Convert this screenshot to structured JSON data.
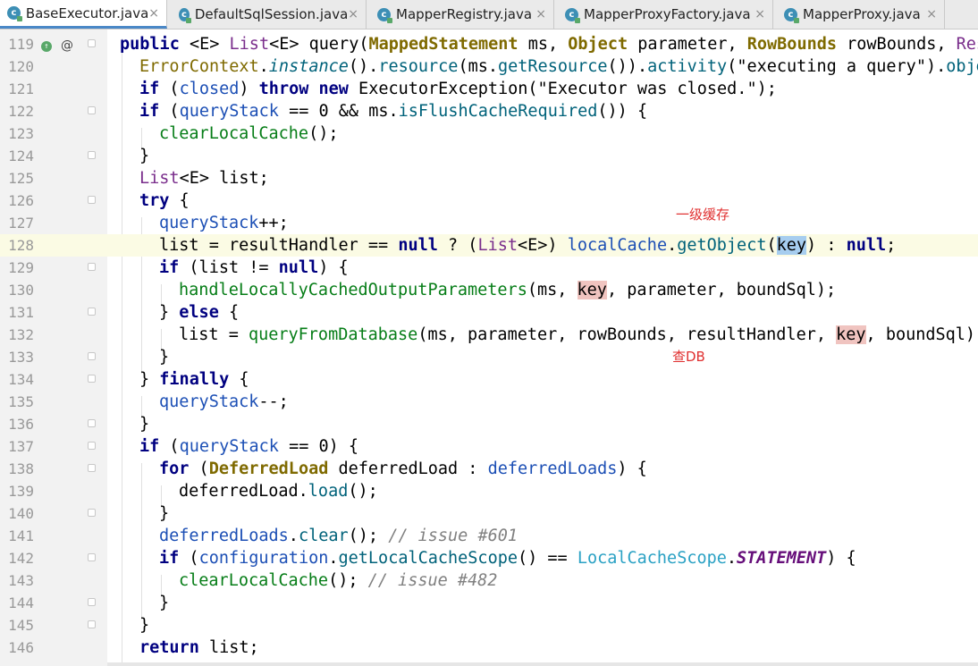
{
  "tabs": [
    {
      "label": "BaseExecutor.java",
      "active": true
    },
    {
      "label": "DefaultSqlSession.java",
      "active": false
    },
    {
      "label": "MapperRegistry.java",
      "active": false
    },
    {
      "label": "MapperProxyFactory.java",
      "active": false
    },
    {
      "label": "MapperProxy.java",
      "active": false
    }
  ],
  "tab_close_glyph": "×",
  "file_icon_letter": "c",
  "gutter": {
    "override_icon": "implements-method-icon",
    "annotation_icon": "@"
  },
  "lines": [
    {
      "n": "119"
    },
    {
      "n": "120"
    },
    {
      "n": "121"
    },
    {
      "n": "122"
    },
    {
      "n": "123"
    },
    {
      "n": "124"
    },
    {
      "n": "125"
    },
    {
      "n": "126"
    },
    {
      "n": "127"
    },
    {
      "n": "128"
    },
    {
      "n": "129"
    },
    {
      "n": "130"
    },
    {
      "n": "131"
    },
    {
      "n": "132"
    },
    {
      "n": "133"
    },
    {
      "n": "134"
    },
    {
      "n": "135"
    },
    {
      "n": "136"
    },
    {
      "n": "137"
    },
    {
      "n": "138"
    },
    {
      "n": "139"
    },
    {
      "n": "140"
    },
    {
      "n": "141"
    },
    {
      "n": "142"
    },
    {
      "n": "143"
    },
    {
      "n": "144"
    },
    {
      "n": "145"
    },
    {
      "n": "146"
    }
  ],
  "code": {
    "l119": {
      "a": "public ",
      "b": "<E> ",
      "c": "List",
      "d": "<E> query(",
      "e": "MappedStatement",
      "f": " ms, ",
      "g": "Object",
      "h": " parameter, ",
      "i": "RowBounds",
      "j": " rowBounds, ",
      "k": "Resu"
    },
    "l120": {
      "a": "ErrorContext",
      "b": ".",
      "c": "instance",
      "d": "().",
      "e": "resource",
      "f": "(ms.",
      "g": "getResource",
      "h": "()).",
      "i": "activity",
      "j": "(\"executing a query\").",
      "k": "objec"
    },
    "l121": {
      "a": "if",
      "b": " (",
      "c": "closed",
      "d": ") ",
      "e": "throw new",
      "f": " ExecutorException(\"Executor was closed.\");"
    },
    "l122": {
      "a": "if",
      "b": " (",
      "c": "queryStack",
      "d": " == ",
      "e": "0",
      "f": " && ms.",
      "g": "isFlushCacheRequired",
      "h": "()) {"
    },
    "l123": {
      "a": "clearLocalCache",
      "b": "();"
    },
    "l124": {
      "a": "}"
    },
    "l125": {
      "a": "List",
      "b": "<E> list;"
    },
    "l126": {
      "a": "try",
      "b": " {"
    },
    "l127": {
      "a": "queryStack",
      "b": "++;"
    },
    "l128": {
      "a": "list = resultHandler == ",
      "b": "null",
      "c": " ? (",
      "d": "List",
      "e": "<E>) ",
      "f": "localCache",
      "g": ".",
      "h": "getObject",
      "i": "(",
      "j": "key",
      "k": ") : ",
      "l": "null",
      "m": ";"
    },
    "l129": {
      "a": "if",
      "b": " (list != ",
      "c": "null",
      "d": ") {"
    },
    "l130": {
      "a": "handleLocallyCachedOutputParameters",
      "b": "(ms, ",
      "c": "key",
      "d": ", parameter, boundSql);"
    },
    "l131": {
      "a": "} ",
      "b": "else",
      "c": " {"
    },
    "l132": {
      "a": "list = ",
      "b": "queryFromDatabase",
      "c": "(ms, parameter, rowBounds, resultHandler, ",
      "d": "key",
      "e": ", boundSql);"
    },
    "l133": {
      "a": "}"
    },
    "l134": {
      "a": "} ",
      "b": "finally",
      "c": " {"
    },
    "l135": {
      "a": "queryStack",
      "b": "--;"
    },
    "l136": {
      "a": "}"
    },
    "l137": {
      "a": "if",
      "b": " (",
      "c": "queryStack",
      "d": " == ",
      "e": "0",
      "f": ") {"
    },
    "l138": {
      "a": "for",
      "b": " (",
      "c": "DeferredLoad",
      "d": " deferredLoad : ",
      "e": "deferredLoads",
      "f": ") {"
    },
    "l139": {
      "a": "deferredLoad.",
      "b": "load",
      "c": "();"
    },
    "l140": {
      "a": "}"
    },
    "l141": {
      "a": "deferredLoads",
      "b": ".",
      "c": "clear",
      "d": "(); ",
      "e": "// issue #601"
    },
    "l142": {
      "a": "if",
      "b": " (",
      "c": "configuration",
      "d": ".",
      "e": "getLocalCacheScope",
      "f": "() == ",
      "g": "LocalCacheScope",
      "h": ".",
      "i": "STATEMENT",
      "j": ") {"
    },
    "l143": {
      "a": "clearLocalCache",
      "b": "(); ",
      "c": "// issue #482"
    },
    "l144": {
      "a": "}"
    },
    "l145": {
      "a": "}"
    },
    "l146": {
      "a": "return",
      "b": " list;"
    }
  },
  "annotations": {
    "level1_cache": "一级缓存",
    "query_db": "查DB"
  },
  "colors": {
    "annotation": "#e03030",
    "keyword": "#000080",
    "selection": "#a6cdef",
    "reference": "#f0c4c0"
  }
}
